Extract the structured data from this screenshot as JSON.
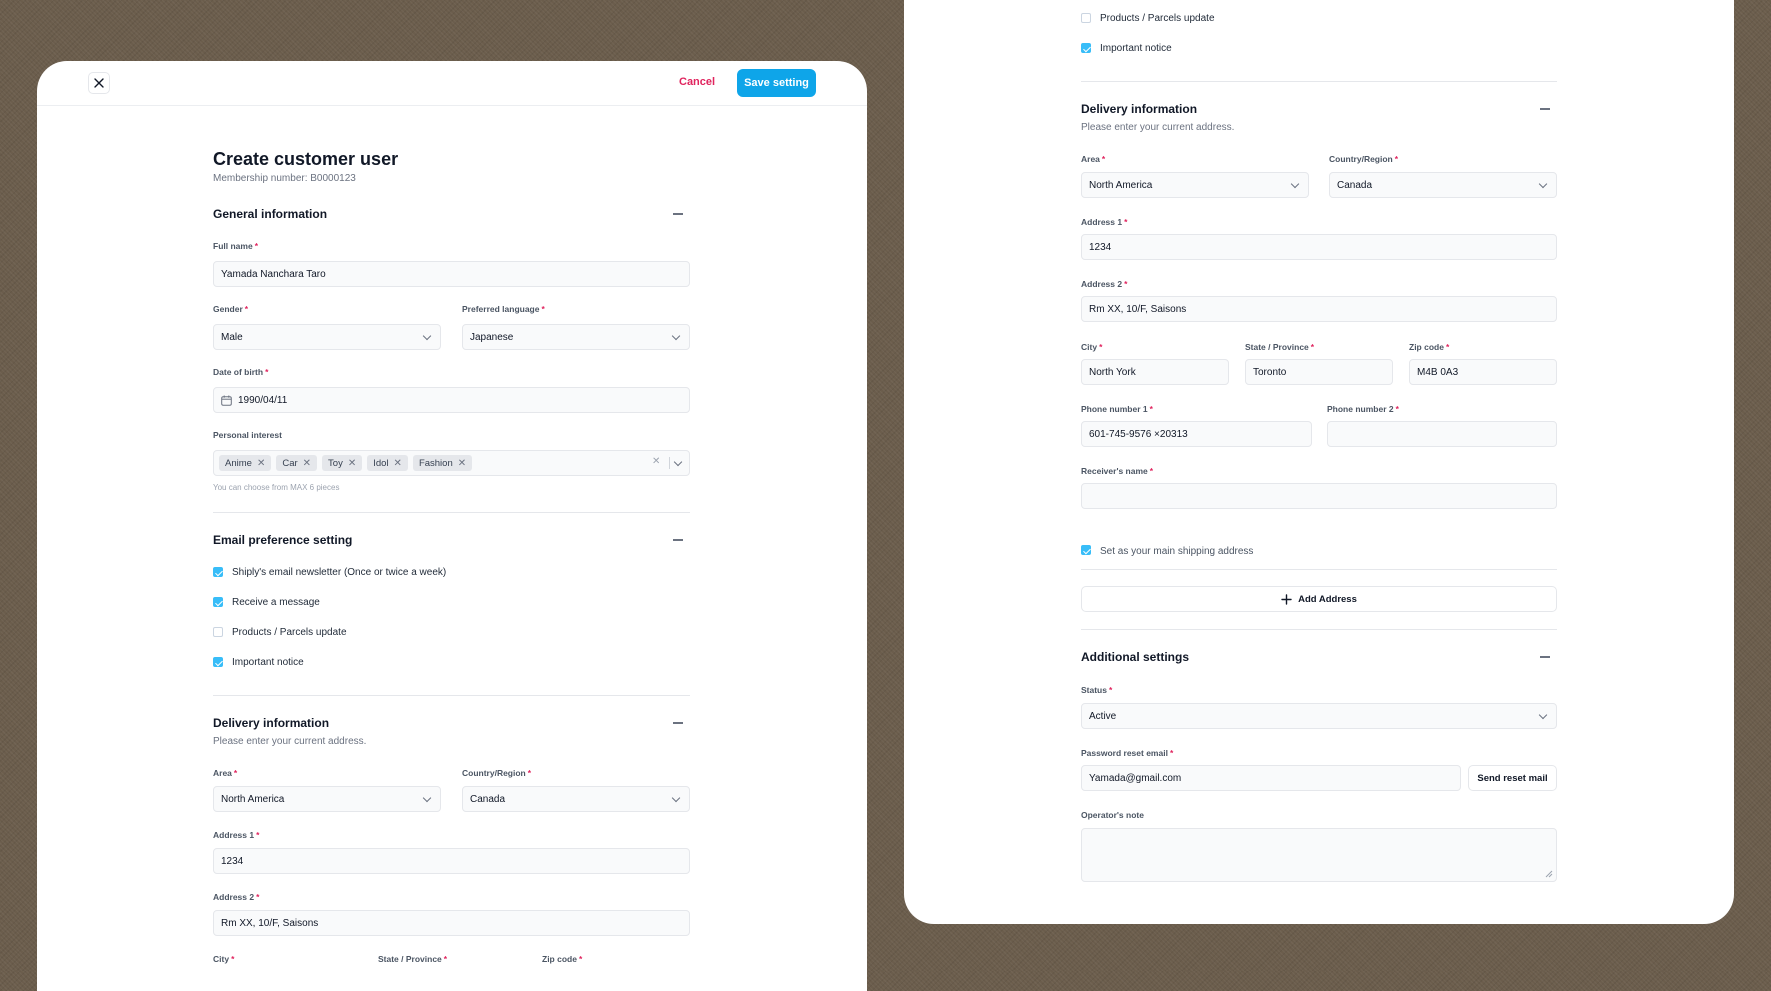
{
  "header": {
    "cancel_label": "Cancel",
    "save_label": "Save setting"
  },
  "page": {
    "title": "Create customer user",
    "membership": "Membership number: B0000123"
  },
  "general": {
    "title": "General information",
    "full_name_label": "Full name",
    "full_name_value": "Yamada Nanchara Taro",
    "gender_label": "Gender",
    "gender_value": "Male",
    "language_label": "Preferred language",
    "language_value": "Japanese",
    "dob_label": "Date of birth",
    "dob_value": "1990/04/11",
    "interest_label": "Personal interest",
    "interests": [
      "Anime",
      "Car",
      "Toy",
      "Idol",
      "Fashion"
    ],
    "interest_hint": "You can choose from MAX 6 pieces"
  },
  "email": {
    "title": "Email preference setting",
    "options": [
      {
        "label": "Shiply's email newsletter (Once or twice a week)",
        "checked": true
      },
      {
        "label": "Receive a message",
        "checked": true
      },
      {
        "label": "Products / Parcels update",
        "checked": false
      },
      {
        "label": "Important notice",
        "checked": true
      }
    ]
  },
  "delivery": {
    "title": "Delivery information",
    "subtitle": "Please enter your current address.",
    "area_label": "Area",
    "area_value": "North America",
    "country_label": "Country/Region",
    "country_value": "Canada",
    "address1_label": "Address 1",
    "address1_value": "1234",
    "address2_label": "Address 2",
    "address2_value": "Rm XX, 10/F, Saisons",
    "city_label": "City",
    "city_value": "North York",
    "state_label": "State / Province",
    "state_value": "Toronto",
    "zip_label": "Zip code",
    "zip_value": "M4B 0A3",
    "phone1_label": "Phone number 1",
    "phone1_value": "601-745-9576 ×20313",
    "phone2_label": "Phone number 2",
    "phone2_value": "",
    "receiver_label": "Receiver's name",
    "receiver_value": "",
    "main_address_label": "Set as your main shipping address",
    "add_address_label": "Add Address"
  },
  "additional": {
    "title": "Additional settings",
    "status_label": "Status",
    "status_value": "Active",
    "reset_label": "Password reset email",
    "reset_value": "Yamada@gmail.com",
    "send_reset_label": "Send reset mail",
    "note_label": "Operator's note"
  },
  "required_mark": "*",
  "colors": {
    "accent": "#0ea5e9",
    "danger": "#e0245e",
    "checkbox": "#38bdf8"
  }
}
